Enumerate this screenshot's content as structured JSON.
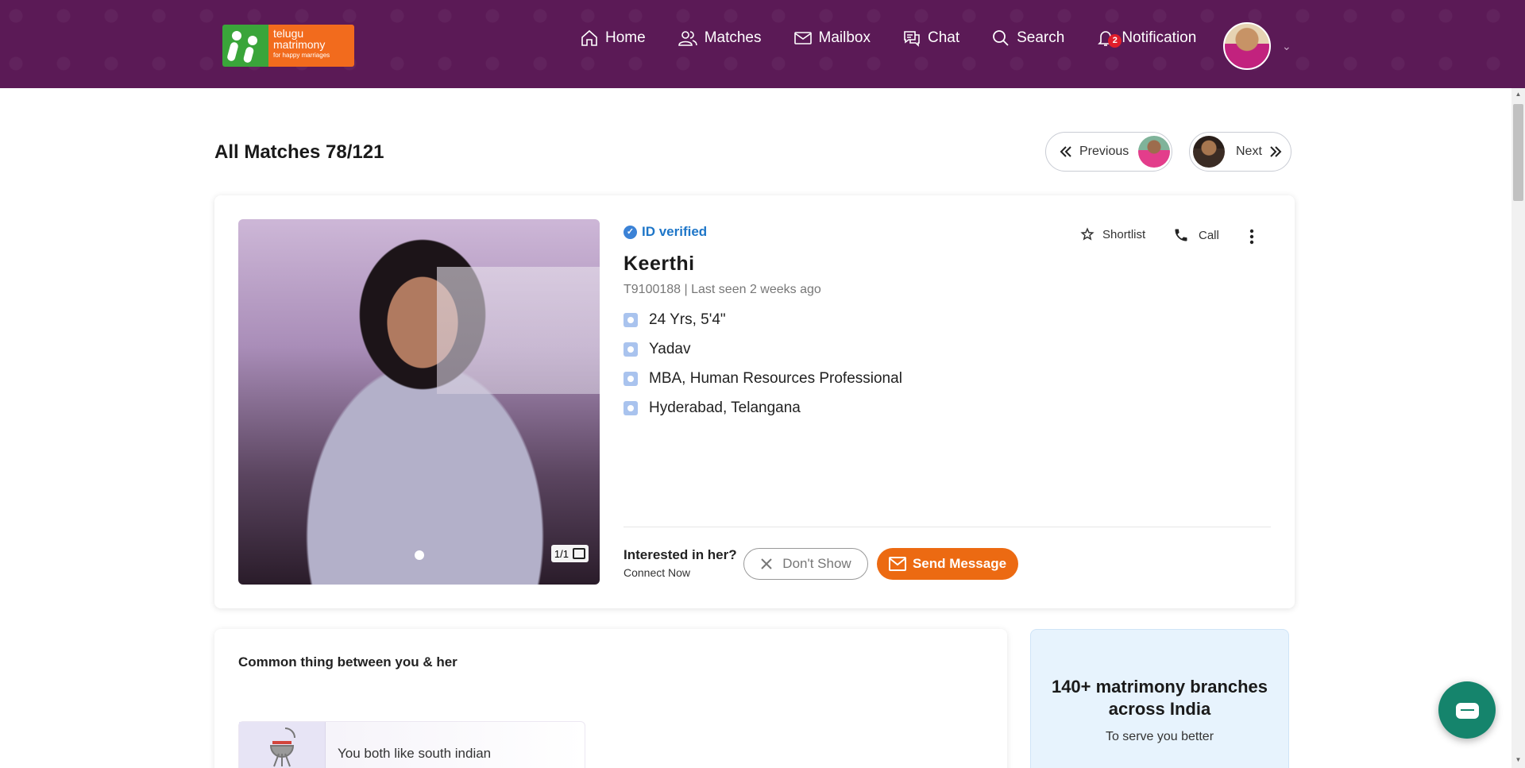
{
  "header": {
    "logo": {
      "line1": "telugu",
      "line2": "matrimony",
      "tagline": "for happy marriages"
    },
    "nav": [
      {
        "label": "Home"
      },
      {
        "label": "Matches"
      },
      {
        "label": "Mailbox"
      },
      {
        "label": "Chat"
      },
      {
        "label": "Search"
      },
      {
        "label": "Notification",
        "badge": "2"
      }
    ]
  },
  "page": {
    "title": "All Matches 78/121",
    "previous_label": "Previous",
    "next_label": "Next"
  },
  "profile": {
    "verified_label": "ID verified",
    "name": "Keerthi",
    "id_line": "T9100188 | Last seen 2 weeks ago",
    "details": [
      "24 Yrs, 5'4\"",
      "Yadav",
      "MBA, Human Resources Professional",
      "Hyderabad, Telangana"
    ],
    "photo_count": "1/1",
    "actions": {
      "shortlist": "Shortlist",
      "call": "Call"
    },
    "interested_question": "Interested in her?",
    "connect_now": "Connect Now",
    "dont_show": "Don't Show",
    "send_message": "Send Message"
  },
  "common": {
    "title": "Common thing between you & her",
    "item": "You both like south indian"
  },
  "branches": {
    "title": "140+ matrimony branches across India",
    "subtitle": "To serve you better"
  },
  "colors": {
    "header_bg": "#5b1a56",
    "accent_orange": "#ec6a12",
    "verified_blue": "#1e76c8"
  }
}
